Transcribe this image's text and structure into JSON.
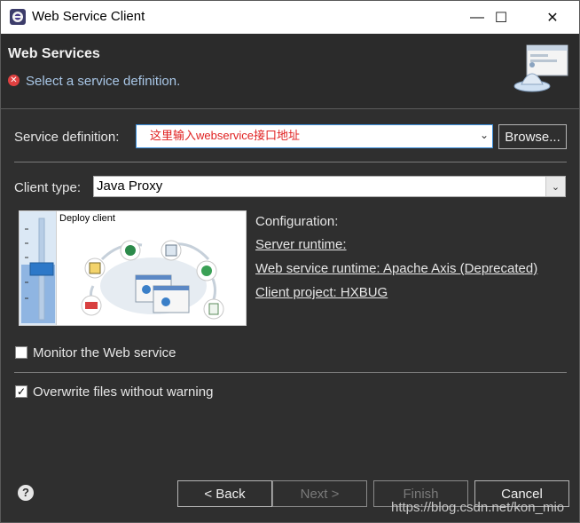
{
  "window": {
    "title": "Web Service Client",
    "minimize_glyph": "—",
    "maximize_glyph": "☐",
    "close_glyph": "✕"
  },
  "header": {
    "page_title": "Web Services",
    "error_message": "Select a service definition.",
    "error_icon": "error-icon",
    "banner_icon": "web-service-banner-icon"
  },
  "service_definition": {
    "label": "Service definition:",
    "value": "这里输入webservice接口地址",
    "browse_label": "Browse..."
  },
  "client_type": {
    "label": "Client type:",
    "value": "Java Proxy"
  },
  "preview": {
    "caption": "Deploy client"
  },
  "configuration": {
    "heading": "Configuration:",
    "server_runtime": "Server runtime: ",
    "web_service_runtime": "Web service runtime: Apache Axis (Deprecated)",
    "client_project": "Client project: HXBUG"
  },
  "options": {
    "monitor_label": "Monitor the Web service",
    "monitor_checked": false,
    "overwrite_label": "Overwrite files without warning",
    "overwrite_checked": true
  },
  "footer": {
    "back_label": "< Back",
    "next_label": "Next >",
    "finish_label": "Finish",
    "cancel_label": "Cancel",
    "watermark": "https://blog.csdn.net/kon_mio"
  },
  "colors": {
    "dialog_bg": "#2f2f2f",
    "error_text": "#a8c6e6",
    "input_text": "#e02020",
    "focus_border": "#3b8fdc"
  }
}
